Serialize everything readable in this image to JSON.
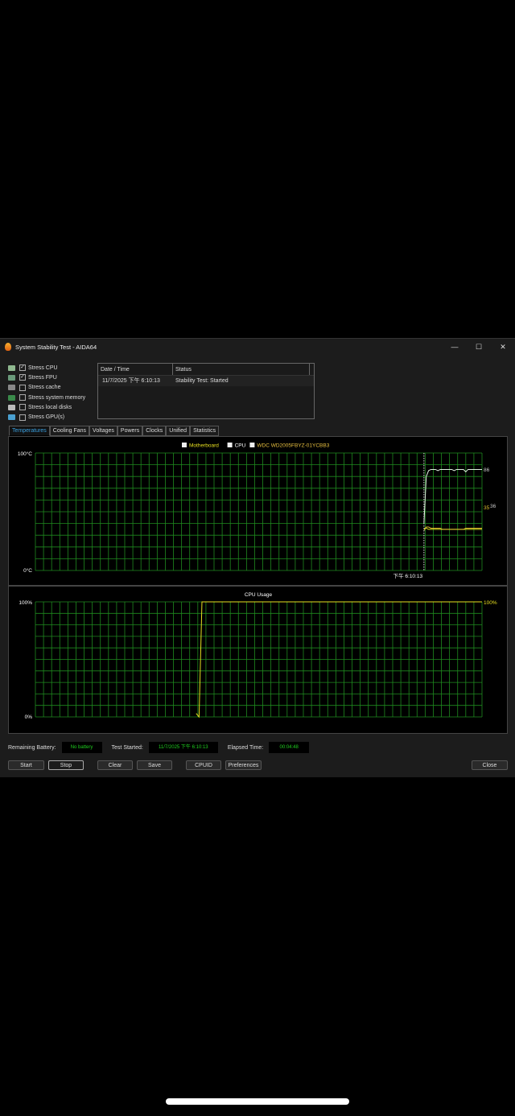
{
  "window": {
    "title": "System Stability Test - AIDA64",
    "minimize": "—",
    "maximize": "☐",
    "close": "✕"
  },
  "options": [
    {
      "label": "Stress CPU",
      "checked": true,
      "icon": "cpu-icon",
      "color": "#8fb88f"
    },
    {
      "label": "Stress FPU",
      "checked": true,
      "icon": "fpu-icon",
      "color": "#6a9a7a"
    },
    {
      "label": "Stress cache",
      "checked": false,
      "icon": "cache-icon",
      "color": "#888"
    },
    {
      "label": "Stress system memory",
      "checked": false,
      "icon": "memory-icon",
      "color": "#3a8a4a"
    },
    {
      "label": "Stress local disks",
      "checked": false,
      "icon": "disk-icon",
      "color": "#bbb"
    },
    {
      "label": "Stress GPU(s)",
      "checked": false,
      "icon": "gpu-icon",
      "color": "#4aa0d0"
    }
  ],
  "log": {
    "columns": [
      "Date / Time",
      "Status"
    ],
    "rows": [
      [
        "11/7/2025 下午 6:10:13",
        "Stability Test: Started"
      ]
    ]
  },
  "tabs": [
    "Temperatures",
    "Cooling Fans",
    "Voltages",
    "Powers",
    "Clocks",
    "Unified",
    "Statistics"
  ],
  "chart_data": [
    {
      "type": "line",
      "ylabel_top": "100°C",
      "ylabel_bottom": "0°C",
      "ylim": [
        0,
        100
      ],
      "xlabel": "下午 6:10:13",
      "start_fraction": 0.87,
      "legend": [
        {
          "name": "Motherboard",
          "color": "#e8e020"
        },
        {
          "name": "CPU",
          "color": "#ffffff"
        },
        {
          "name": "WDC WD2005FBYZ-01YCBB3",
          "color": "#e8c040"
        }
      ],
      "series": [
        {
          "name": "CPU",
          "color": "#e0f0e0",
          "values": [
            40,
            80,
            85,
            86,
            86,
            86,
            85,
            86,
            86,
            86,
            86,
            86,
            86,
            85,
            86,
            86,
            86,
            86,
            84,
            86,
            86,
            86,
            86,
            86,
            86,
            86
          ]
        },
        {
          "name": "Motherboard",
          "color": "#d8e020",
          "values": [
            36,
            36,
            35,
            35,
            35,
            35,
            35,
            35,
            35,
            35,
            35,
            35,
            35,
            35,
            35,
            35,
            35,
            35,
            35,
            35,
            35,
            35,
            35,
            35,
            35,
            35
          ]
        },
        {
          "name": "WDC WD2005FBYZ-01YCBB3",
          "color": "#e0c030",
          "values": [
            34,
            37,
            37,
            36,
            36,
            36,
            36,
            36,
            35,
            35,
            35,
            35,
            35,
            35,
            35,
            35,
            35,
            35,
            36,
            36,
            36,
            36,
            36,
            36,
            36,
            36
          ]
        }
      ],
      "end_labels": [
        "86",
        "35",
        "36"
      ],
      "grid": true
    },
    {
      "type": "line",
      "title": "CPU Usage",
      "ylabel_top": "100%",
      "ylabel_bottom": "0%",
      "ylim": [
        0,
        100
      ],
      "start_fraction": 0.36,
      "end_label": "100%",
      "series": [
        {
          "name": "CPU Usage",
          "color": "#e8e020",
          "values": [
            3,
            0,
            100,
            100,
            100,
            100,
            100,
            100,
            100,
            100,
            100,
            100,
            100,
            100,
            100,
            100,
            100,
            100,
            100,
            100,
            100,
            100,
            100,
            100,
            100,
            100,
            100,
            100,
            100,
            100,
            100,
            100,
            100,
            100,
            100,
            100,
            100,
            100,
            100,
            100,
            100,
            100,
            100,
            100,
            100,
            100,
            100,
            100,
            100,
            100,
            100,
            100,
            100,
            100,
            100,
            100,
            100,
            100,
            100,
            100,
            100,
            100,
            100,
            100,
            100,
            100,
            100,
            100,
            100,
            100,
            100,
            100,
            100,
            100,
            100,
            100,
            100,
            100,
            100,
            100,
            100,
            100,
            100,
            100,
            100,
            100,
            100,
            100,
            100,
            100,
            100,
            100,
            100,
            100,
            100,
            100,
            100,
            100,
            100,
            100
          ]
        }
      ],
      "grid": true
    }
  ],
  "status": {
    "battery_label": "Remaining Battery:",
    "battery_value": "No battery",
    "started_label": "Test Started:",
    "started_value": "11/7/2025 下午 6:10:13",
    "elapsed_label": "Elapsed Time:",
    "elapsed_value": "00:04:48"
  },
  "buttons": {
    "start": "Start",
    "stop": "Stop",
    "clear": "Clear",
    "save": "Save",
    "cpuid": "CPUID",
    "preferences": "Preferences",
    "close": "Close"
  }
}
